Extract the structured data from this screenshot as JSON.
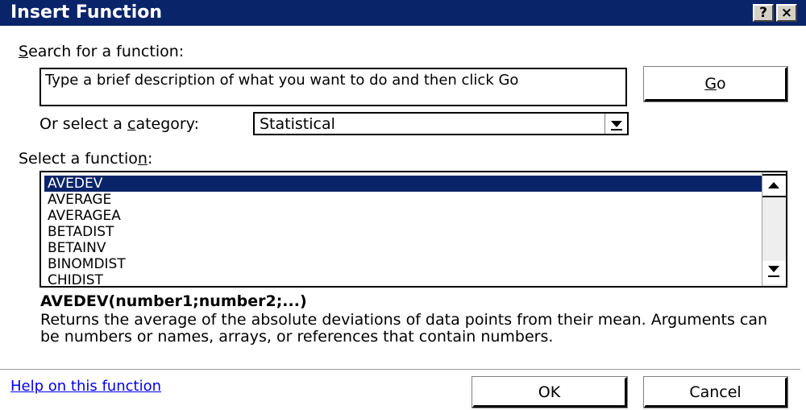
{
  "dialog": {
    "title": "Insert Function",
    "help_button": "?",
    "close_button": "×"
  },
  "search": {
    "label_underlined": "S",
    "label_rest": "earch for a function:",
    "value": "Type a brief description of what you want to do and then click Go",
    "go_underlined": "G",
    "go_rest": "o"
  },
  "category": {
    "label_pre": "Or select a ",
    "label_underlined": "c",
    "label_post": "ategory:",
    "selected": "Statistical"
  },
  "functions": {
    "label_pre": "Select a functio",
    "label_underlined": "n",
    "label_post": ":",
    "items": [
      "AVEDEV",
      "AVERAGE",
      "AVERAGEA",
      "BETADIST",
      "BETAINV",
      "BINOMDIST",
      "CHIDIST"
    ],
    "selected_index": 0
  },
  "details": {
    "syntax": "AVEDEV(number1;number2;...)",
    "description": "Returns the average of the absolute deviations of data points from their mean. Arguments can be numbers or names, arrays, or references that contain numbers."
  },
  "footer": {
    "help_link": "Help on this function",
    "ok_label": "OK",
    "cancel_label": "Cancel"
  }
}
